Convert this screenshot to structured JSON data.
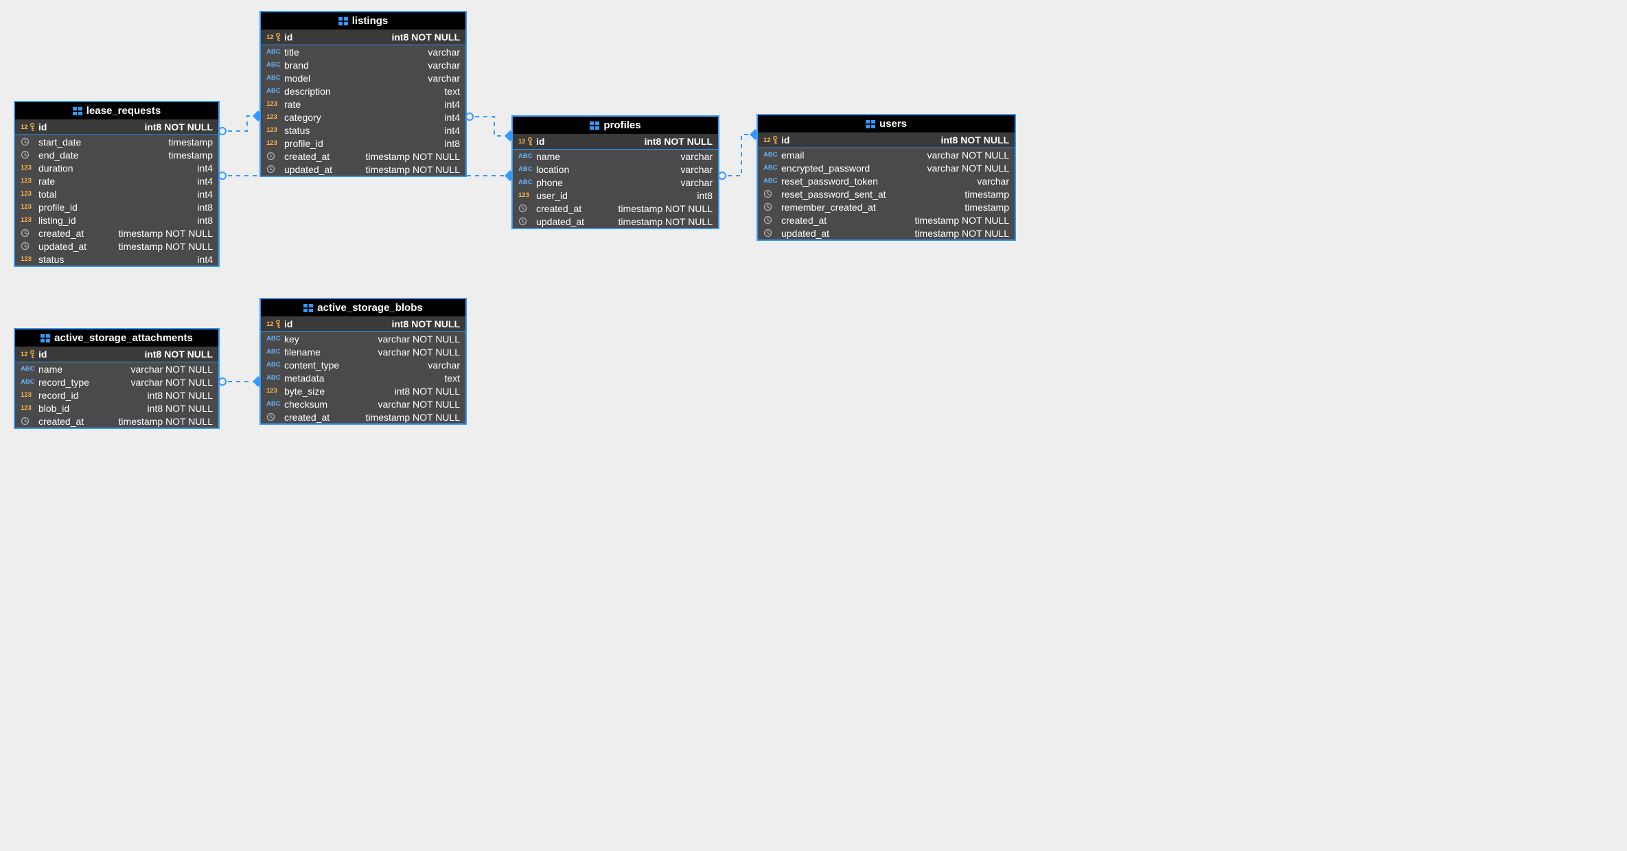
{
  "tables": {
    "lease_requests": {
      "title": "lease_requests",
      "pk": {
        "name": "id",
        "type": "int8 NOT NULL"
      },
      "cols": [
        {
          "icon": "ts",
          "name": "start_date",
          "type": "timestamp"
        },
        {
          "icon": "ts",
          "name": "end_date",
          "type": "timestamp"
        },
        {
          "icon": "num",
          "name": "duration",
          "type": "int4"
        },
        {
          "icon": "num",
          "name": "rate",
          "type": "int4"
        },
        {
          "icon": "num",
          "name": "total",
          "type": "int4"
        },
        {
          "icon": "num",
          "name": "profile_id",
          "type": "int8"
        },
        {
          "icon": "num",
          "name": "listing_id",
          "type": "int8"
        },
        {
          "icon": "ts",
          "name": "created_at",
          "type": "timestamp NOT NULL"
        },
        {
          "icon": "ts",
          "name": "updated_at",
          "type": "timestamp NOT NULL"
        },
        {
          "icon": "num",
          "name": "status",
          "type": "int4"
        }
      ]
    },
    "listings": {
      "title": "listings",
      "pk": {
        "name": "id",
        "type": "int8 NOT NULL"
      },
      "cols": [
        {
          "icon": "abc",
          "name": "title",
          "type": "varchar"
        },
        {
          "icon": "abc",
          "name": "brand",
          "type": "varchar"
        },
        {
          "icon": "abc",
          "name": "model",
          "type": "varchar"
        },
        {
          "icon": "abc",
          "name": "description",
          "type": "text"
        },
        {
          "icon": "num",
          "name": "rate",
          "type": "int4"
        },
        {
          "icon": "num",
          "name": "category",
          "type": "int4"
        },
        {
          "icon": "num",
          "name": "status",
          "type": "int4"
        },
        {
          "icon": "num",
          "name": "profile_id",
          "type": "int8"
        },
        {
          "icon": "ts",
          "name": "created_at",
          "type": "timestamp NOT NULL"
        },
        {
          "icon": "ts",
          "name": "updated_at",
          "type": "timestamp NOT NULL"
        }
      ]
    },
    "profiles": {
      "title": "profiles",
      "pk": {
        "name": "id",
        "type": "int8 NOT NULL"
      },
      "cols": [
        {
          "icon": "abc",
          "name": "name",
          "type": "varchar"
        },
        {
          "icon": "abc",
          "name": "location",
          "type": "varchar"
        },
        {
          "icon": "abc",
          "name": "phone",
          "type": "varchar"
        },
        {
          "icon": "num",
          "name": "user_id",
          "type": "int8"
        },
        {
          "icon": "ts",
          "name": "created_at",
          "type": "timestamp NOT NULL"
        },
        {
          "icon": "ts",
          "name": "updated_at",
          "type": "timestamp NOT NULL"
        }
      ]
    },
    "users": {
      "title": "users",
      "pk": {
        "name": "id",
        "type": "int8 NOT NULL"
      },
      "cols": [
        {
          "icon": "abc",
          "name": "email",
          "type": "varchar NOT NULL"
        },
        {
          "icon": "abc",
          "name": "encrypted_password",
          "type": "varchar NOT NULL"
        },
        {
          "icon": "abc",
          "name": "reset_password_token",
          "type": "varchar"
        },
        {
          "icon": "ts",
          "name": "reset_password_sent_at",
          "type": "timestamp"
        },
        {
          "icon": "ts",
          "name": "remember_created_at",
          "type": "timestamp"
        },
        {
          "icon": "ts",
          "name": "created_at",
          "type": "timestamp NOT NULL"
        },
        {
          "icon": "ts",
          "name": "updated_at",
          "type": "timestamp NOT NULL"
        }
      ]
    },
    "active_storage_attachments": {
      "title": "active_storage_attachments",
      "pk": {
        "name": "id",
        "type": "int8 NOT NULL"
      },
      "cols": [
        {
          "icon": "abc",
          "name": "name",
          "type": "varchar NOT NULL"
        },
        {
          "icon": "abc",
          "name": "record_type",
          "type": "varchar NOT NULL"
        },
        {
          "icon": "num",
          "name": "record_id",
          "type": "int8 NOT NULL"
        },
        {
          "icon": "num",
          "name": "blob_id",
          "type": "int8 NOT NULL"
        },
        {
          "icon": "ts",
          "name": "created_at",
          "type": "timestamp NOT NULL"
        }
      ]
    },
    "active_storage_blobs": {
      "title": "active_storage_blobs",
      "pk": {
        "name": "id",
        "type": "int8 NOT NULL"
      },
      "cols": [
        {
          "icon": "abc",
          "name": "key",
          "type": "varchar NOT NULL"
        },
        {
          "icon": "abc",
          "name": "filename",
          "type": "varchar NOT NULL"
        },
        {
          "icon": "abc",
          "name": "content_type",
          "type": "varchar"
        },
        {
          "icon": "abc",
          "name": "metadata",
          "type": "text"
        },
        {
          "icon": "num",
          "name": "byte_size",
          "type": "int8 NOT NULL"
        },
        {
          "icon": "abc",
          "name": "checksum",
          "type": "varchar NOT NULL"
        },
        {
          "icon": "ts",
          "name": "created_at",
          "type": "timestamp NOT NULL"
        }
      ]
    }
  },
  "relations": [
    {
      "from": "lease_requests.listing_id",
      "to": "listings.id"
    },
    {
      "from": "lease_requests.profile_id",
      "to": "profiles.id"
    },
    {
      "from": "listings.profile_id",
      "to": "profiles.id"
    },
    {
      "from": "profiles.user_id",
      "to": "users.id"
    },
    {
      "from": "active_storage_attachments.blob_id",
      "to": "active_storage_blobs.id"
    }
  ]
}
